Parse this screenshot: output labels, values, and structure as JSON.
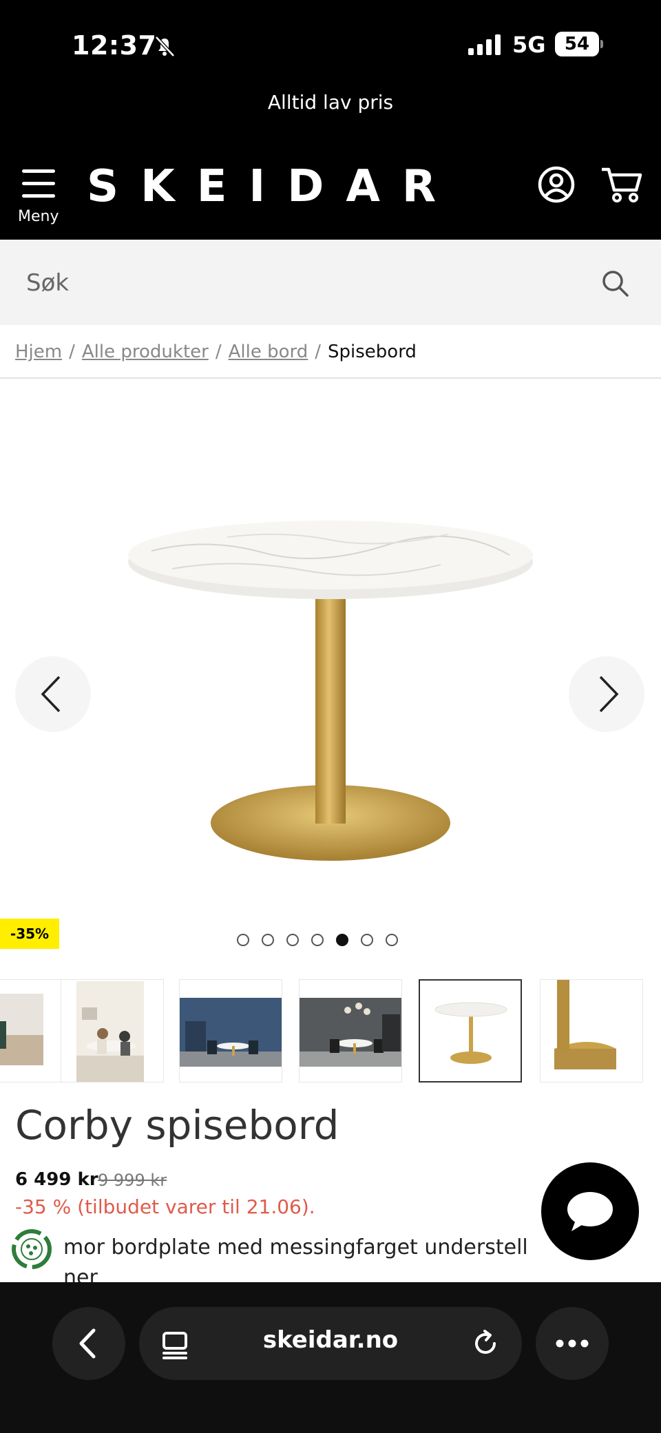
{
  "status_bar": {
    "time": "12:37",
    "network": "5G",
    "battery": "54"
  },
  "header": {
    "promo": "Alltid lav pris",
    "menu_label": "Meny",
    "logo": "SKEIDAR",
    "icons": [
      "menu-icon",
      "account-icon",
      "cart-icon"
    ]
  },
  "search": {
    "placeholder": "Søk"
  },
  "breadcrumb": {
    "items": [
      "Hjem",
      "Alle produkter",
      "Alle bord"
    ],
    "current": "Spisebord",
    "separator": "/"
  },
  "gallery": {
    "discount_badge": "-35%",
    "dot_count": 7,
    "active_dot": 5,
    "thumbnail_count": 6,
    "selected_thumbnail": 5
  },
  "product": {
    "title": "Corby spisebord",
    "price": "6 499 kr",
    "old_price": "9 999 kr",
    "offer_text": "-35 % (tilbudet varer til 21.06).",
    "description_line1": "mor bordplate med messingfarget understell",
    "description_line2": "ner"
  },
  "browser": {
    "url": "skeidar.no"
  },
  "colors": {
    "header_bg": "#000000",
    "search_bg": "#f3f3f3",
    "badge_bg": "#ffee00",
    "offer_red": "#e05a4a",
    "brass": "#c9a24a"
  }
}
